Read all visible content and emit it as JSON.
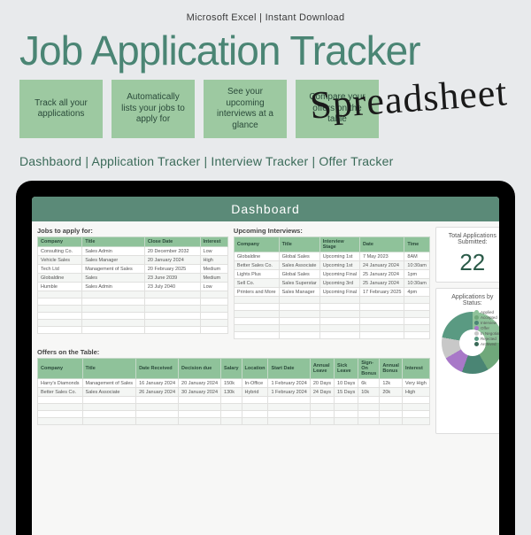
{
  "topline": "Microsoft Excel    |    Instant Download",
  "title": "Job Application Tracker",
  "ribbons": [
    "Track all your applications",
    "Automatically lists your jobs to apply for",
    "See your upcoming interviews at a glance",
    "Compare your offers on the table"
  ],
  "script": "Spreadsheet",
  "subnav": "Dashbaord | Application Tracker | Interview Tracker | Offer Tracker",
  "dash_head": "Dashboard",
  "sections": {
    "jobs": {
      "title": "Jobs to apply for:",
      "headers": [
        "Company",
        "Title",
        "Close Date",
        "Interest"
      ],
      "rows": [
        [
          "Consulting Co.",
          "Sales Admin",
          "20 December 2032",
          "Low"
        ],
        [
          "Vehicle Sales",
          "Sales Manager",
          "20 January 2024",
          "High"
        ],
        [
          "Tech Ltd",
          "Management of Sales",
          "20 February 2025",
          "Medium"
        ],
        [
          "Globaldine",
          "Sales",
          "23 June 2039",
          "Medium"
        ],
        [
          "Humble",
          "Sales Admin",
          "23 July 2040",
          "Low"
        ]
      ]
    },
    "interviews": {
      "title": "Upcoming Interviews:",
      "headers": [
        "Company",
        "Title",
        "Interview Stage",
        "Date",
        "Time"
      ],
      "rows": [
        [
          "Globaldine",
          "Global Sales",
          "Upcoming 1st",
          "7 May 2023",
          "8AM"
        ],
        [
          "Better Sales Co.",
          "Sales Associate",
          "Upcoming 1st",
          "24 January 2024",
          "10:30am"
        ],
        [
          "Lights Plus",
          "Global Sales",
          "Upcoming Final",
          "25 January 2024",
          "1pm"
        ],
        [
          "Sell Co.",
          "Sales Superstar",
          "Upcoming 3rd",
          "25 January 2024",
          "10:30am"
        ],
        [
          "Printers and More",
          "Sales Manager",
          "Upcoming Final",
          "17 February 2025",
          "4pm"
        ]
      ]
    },
    "offers": {
      "title": "Offers on the Table:",
      "headers": [
        "Company",
        "Title",
        "Date Received",
        "Decision due",
        "Salary",
        "Location",
        "Start Date",
        "Annual Leave",
        "Sick Leave",
        "Sign-On Bonus",
        "Annual Bonus",
        "Interest"
      ],
      "rows": [
        [
          "Harry's Diamonds",
          "Management of Sales",
          "16 January 2024",
          "20 January 2024",
          "150k",
          "In-Office",
          "1 February 2024",
          "20 Days",
          "10 Days",
          "6k",
          "12k",
          "Very High"
        ],
        [
          "Better Sales Co.",
          "Sales Associate",
          "26 January 2024",
          "30 January 2024",
          "130k",
          "Hybrid",
          "1 February 2024",
          "24 Days",
          "15 Days",
          "10k",
          "20k",
          "High"
        ]
      ]
    }
  },
  "total": {
    "title": "Total Applications Submitted:",
    "value": "22"
  },
  "status": {
    "title": "Applications by Status:",
    "legend": [
      "Applied",
      "Accepted",
      "Interview",
      "Offer",
      "In Negotiating",
      "Rejected",
      "Archived"
    ]
  }
}
